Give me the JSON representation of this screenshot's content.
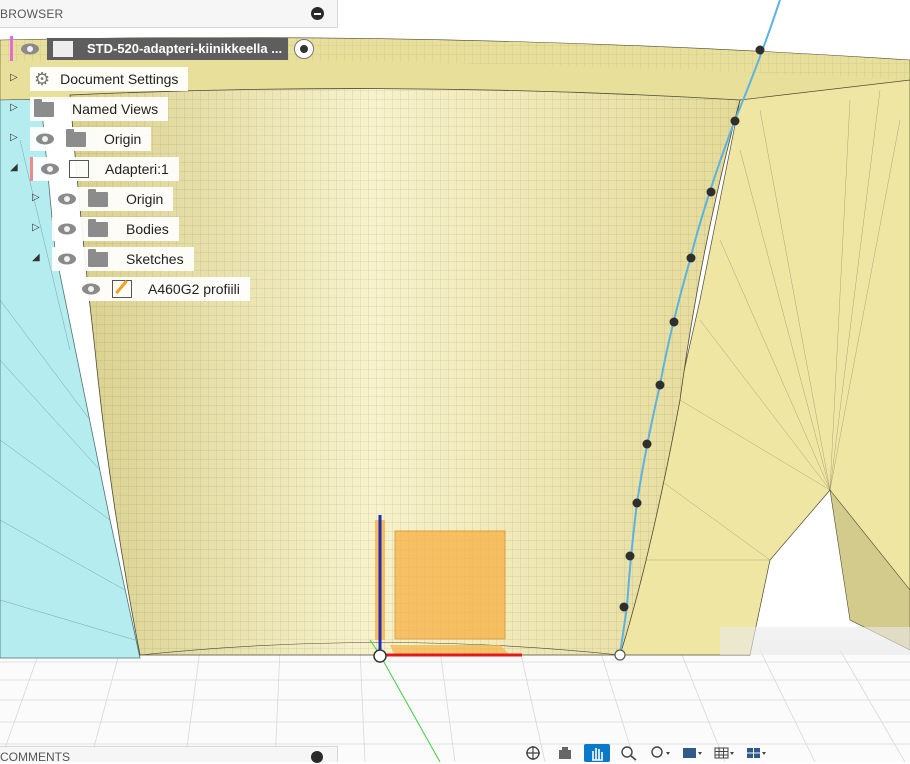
{
  "browser": {
    "title": "BROWSER",
    "root": "STD-520-adapteri-kiinikkeella ...",
    "items": [
      {
        "label": "Document Settings"
      },
      {
        "label": "Named Views"
      },
      {
        "label": "Origin"
      },
      {
        "label": "Adapteri:1"
      },
      {
        "label": "Origin"
      },
      {
        "label": "Bodies"
      },
      {
        "label": "Sketches"
      },
      {
        "label": "A460G2 profiili"
      }
    ]
  },
  "comments": {
    "title": "COMMENTS"
  },
  "toolbar": {
    "items": [
      "orbit-icon",
      "look-at-icon",
      "pan-icon",
      "zoom-icon",
      "fit-icon",
      "display-mode-icon",
      "grid-icon",
      "viewports-icon"
    ]
  },
  "colors": {
    "model_fill": "#f1eaa8",
    "model_edge": "#4d4a33",
    "side_fill": "#b5ecef",
    "sketch_line": "#5bb3e0",
    "selection": "#f7b043"
  }
}
